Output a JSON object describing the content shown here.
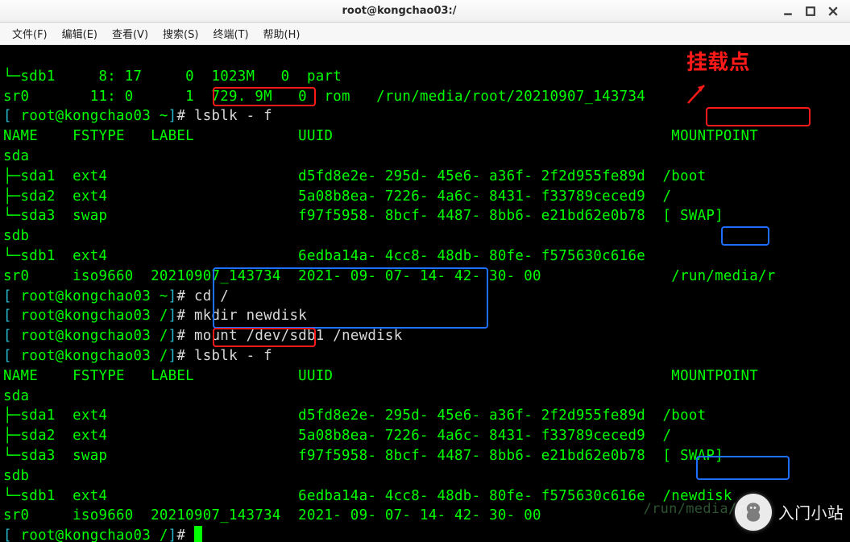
{
  "window": {
    "title": "root@kongchao03:/"
  },
  "menu": {
    "file": "文件(F)",
    "edit": "编辑(E)",
    "view": "查看(V)",
    "search": "搜索(S)",
    "term": "终端(T)",
    "help": "帮助(H)"
  },
  "annot": {
    "label": "挂载点",
    "faded_mount": "/run/media/r"
  },
  "watermark": {
    "text": "入门小站"
  },
  "term": {
    "l1": "└─sdb1     8: 17     0  1023M   0  part",
    "l2": "sr0       11: 0      1  729. 9M   0  rom   /run/media/root/20210907_143734",
    "p1_open": "[",
    "p1_user": " root@kongchao03 ~",
    "p1_close": "]",
    "p1_hash": "# ",
    "p1_cmd": "lsblk - f",
    "hdr1": "NAME    FSTYPE   LABEL            UUID                                       MOUNTPOINT",
    "sda": "sda",
    "sda1": "├─sda1  ext4                      d5fd8e2e- 295d- 45e6- a36f- 2f2d955fe89d  /boot",
    "sda2": "├─sda2  ext4                      5a08b8ea- 7226- 4a6c- 8431- f33789ceced9  /",
    "sda3": "└─sda3  swap                      f97f5958- 8bcf- 4487- 8bb6- e21bd62e0b78  [ SWAP]",
    "sdb": "sdb",
    "sdb1": "└─sdb1  ext4                      6edba14a- 4cc8- 48db- 80fe- f575630c616e",
    "sr0a": "sr0     iso9660  20210907_143734  2021- 09- 07- 14- 42- 30- 00               /run/media/r",
    "p2_open": "[",
    "p2_user": " root@kongchao03 ~",
    "p2_close": "]",
    "p2_hash": "# ",
    "p2_cmd": "cd /",
    "p3_open": "[",
    "p3_user": " root@kongchao03 /",
    "p3_close": "]",
    "p3_hash": "# ",
    "p3_cmd": "mkdir newdisk",
    "p4_open": "[",
    "p4_user": " root@kongchao03 /",
    "p4_close": "]",
    "p4_hash": "# ",
    "p4_cmd": "mount /dev/sdb1 /newdisk",
    "p5_open": "[",
    "p5_user": " root@kongchao03 /",
    "p5_close": "]",
    "p5_hash": "# ",
    "p5_cmd": "lsblk - f",
    "hdr2": "NAME    FSTYPE   LABEL            UUID                                       MOUNTPOINT",
    "sdaB": "sda",
    "sda1B": "├─sda1  ext4                      d5fd8e2e- 295d- 45e6- a36f- 2f2d955fe89d  /boot",
    "sda2B": "├─sda2  ext4                      5a08b8ea- 7226- 4a6c- 8431- f33789ceced9  /",
    "sda3B": "└─sda3  swap                      f97f5958- 8bcf- 4487- 8bb6- e21bd62e0b78  [ SWAP]",
    "sdbB": "sdb",
    "sdb1B": "└─sdb1  ext4                      6edba14a- 4cc8- 48db- 80fe- f575630c616e  /newdisk",
    "sr0B": "sr0     iso9660  20210907_143734  2021- 09- 07- 14- 42- 30- 00",
    "p6_open": "[",
    "p6_user": " root@kongchao03 /",
    "p6_close": "]",
    "p6_hash": "# "
  }
}
